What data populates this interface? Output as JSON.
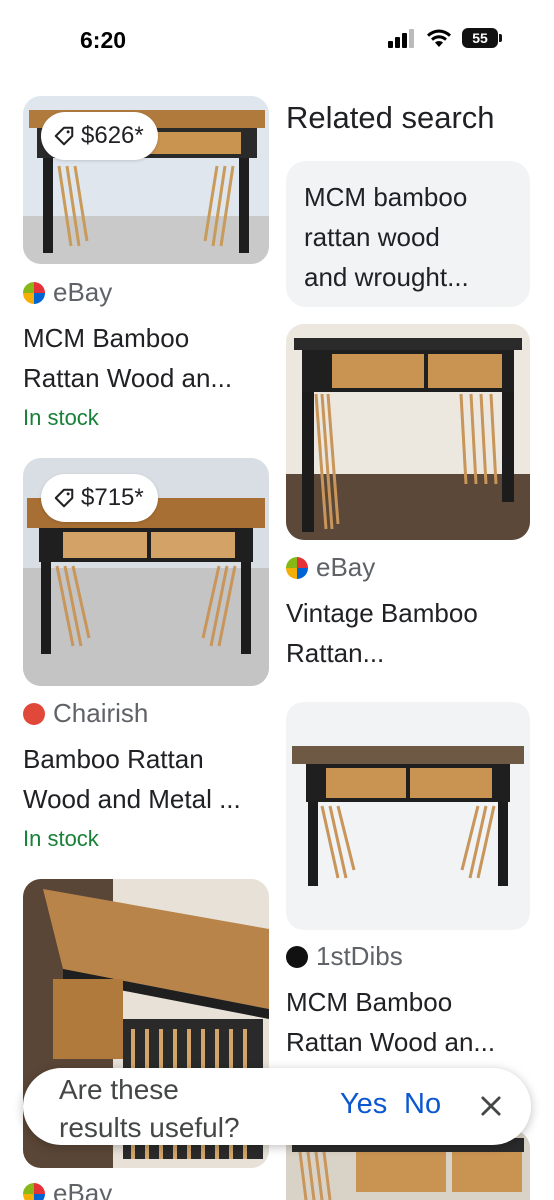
{
  "status_bar": {
    "time": "6:20",
    "battery": "55"
  },
  "results": [
    {
      "price": "$626*",
      "source": "eBay",
      "title_line1": "MCM Bamboo",
      "title_line2": "Rattan Wood an...",
      "availability": "In stock"
    },
    {
      "price": "$715*",
      "source": "Chairish",
      "title_line1": "Bamboo Rattan",
      "title_line2": "Wood and Metal ...",
      "availability": "In stock"
    },
    {
      "source": "eBay"
    }
  ],
  "related": {
    "heading": "Related search",
    "chip_line1": "MCM bamboo",
    "chip_line2": "rattan wood",
    "chip_line3": "and wrought..."
  },
  "right_results": [
    {
      "source": "eBay",
      "title_line1": "Vintage Bamboo",
      "title_line2": "Rattan..."
    },
    {
      "source": "1stDibs",
      "title_line1": "MCM Bamboo",
      "title_line2": "Rattan Wood an..."
    }
  ],
  "feedback": {
    "question_line1": "Are these",
    "question_line2": "results useful?",
    "yes": "Yes",
    "no": "No"
  },
  "colors": {
    "link_blue": "#0b57d0",
    "stock_green": "#188038",
    "chip_bg": "#f1f3f4"
  },
  "icons": [
    "tag-icon",
    "ebay-favicon",
    "chairish-favicon",
    "1stdibs-favicon",
    "close-icon",
    "signal-icon",
    "wifi-icon",
    "battery-icon"
  ]
}
